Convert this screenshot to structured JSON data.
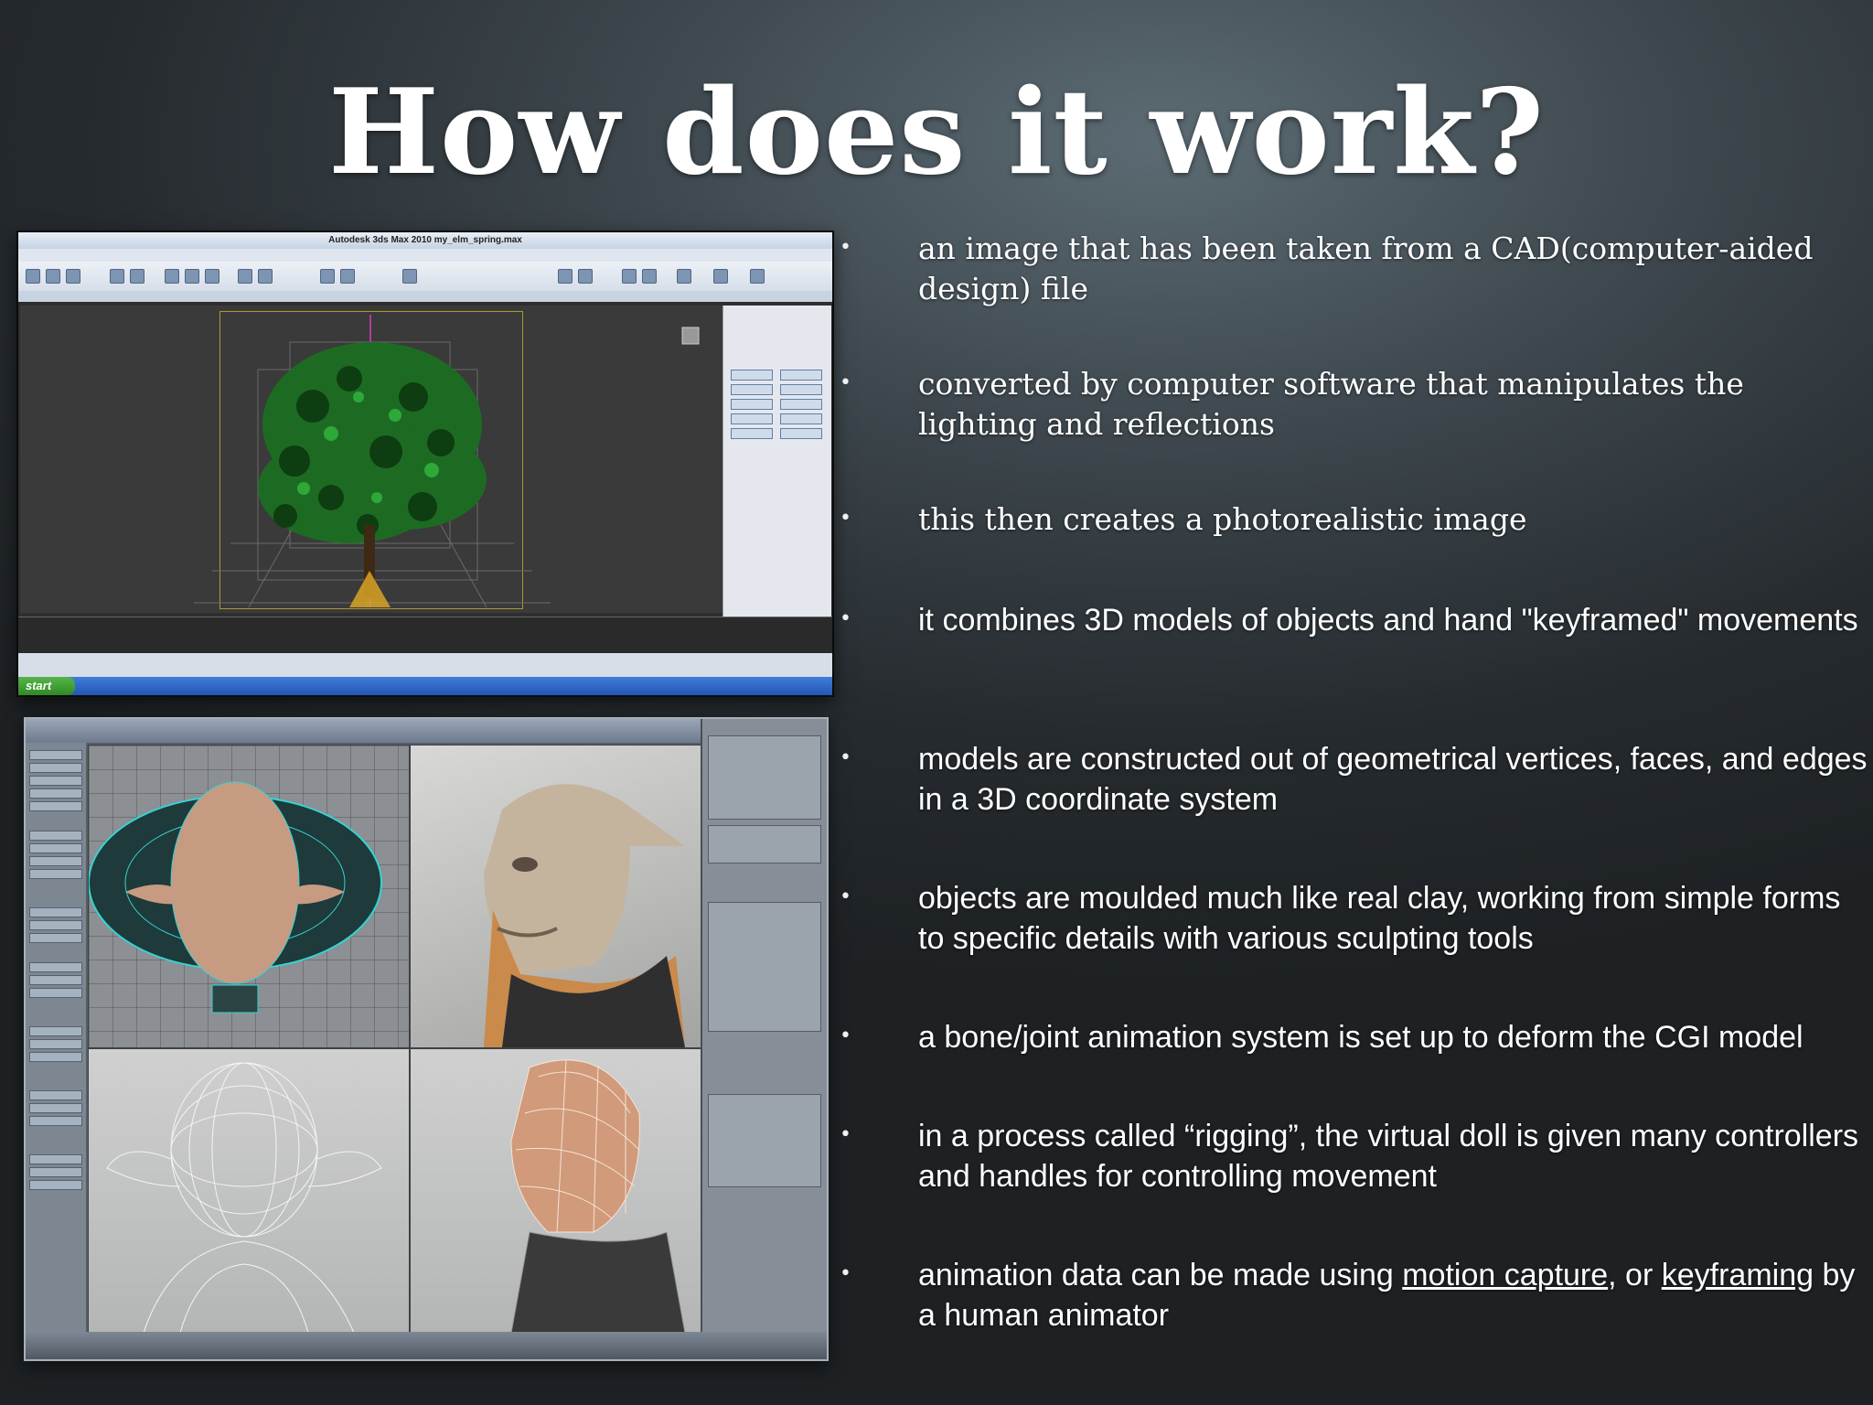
{
  "slide": {
    "title": "How does it work?"
  },
  "screenshots": {
    "max": {
      "window_title": "Autodesk 3ds Max  2010    my_elm_spring.max",
      "start_label": "start"
    }
  },
  "bullets": [
    {
      "text": "an image that has been taken from a CAD(computer-aided design) file"
    },
    {
      "text": "converted by computer software that manipulates the lighting and reflections"
    },
    {
      "text": "this then creates a photorealistic image"
    },
    {
      "text": "it combines 3D models of objects and hand \"keyframed\" movements"
    },
    {
      "text": "models are constructed out of geometrical vertices, faces, and edges in a 3D coordinate system"
    },
    {
      "text": "objects are moulded much like real clay, working from simple forms to specific details with various sculpting tools"
    },
    {
      "text": "a bone/joint animation system is set up to deform the CGI model"
    },
    {
      "text": "in a process called “rigging”, the virtual doll is given many controllers and handles for controlling movement"
    },
    {
      "prefix": "animation data can be made using ",
      "link1": "motion capture",
      "middle": ", or ",
      "link2": "keyframing",
      "suffix": " by a human animator"
    }
  ],
  "colors": {
    "background": "#2a3034",
    "text": "#ffffff"
  }
}
